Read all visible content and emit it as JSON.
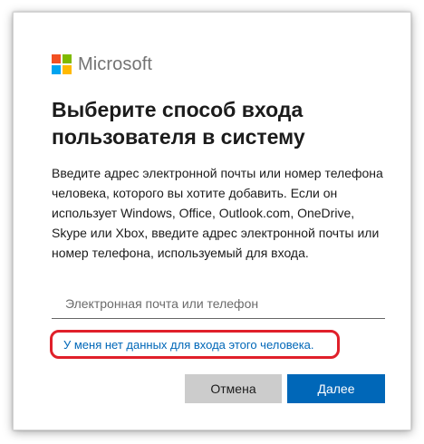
{
  "brand": {
    "name": "Microsoft",
    "logo_colors": [
      "#f25022",
      "#7fba00",
      "#00a4ef",
      "#ffb900"
    ]
  },
  "dialog": {
    "title": "Выберите способ входа пользователя в систему",
    "description": "Введите адрес электронной почты или номер телефона человека, которого вы хотите добавить. Если он использует Windows, Office, Outlook.com, OneDrive, Skype или Xbox, введите адрес электронной почты или номер телефона, используемый для входа.",
    "email_field": {
      "value": "",
      "placeholder": "Электронная почта или телефон"
    },
    "no_data_link": "У меня нет данных для входа этого человека.",
    "buttons": {
      "cancel": "Отмена",
      "next": "Далее"
    }
  },
  "colors": {
    "accent": "#0067b8",
    "highlight": "#e0202a",
    "cancel_bg": "#cccccc"
  }
}
